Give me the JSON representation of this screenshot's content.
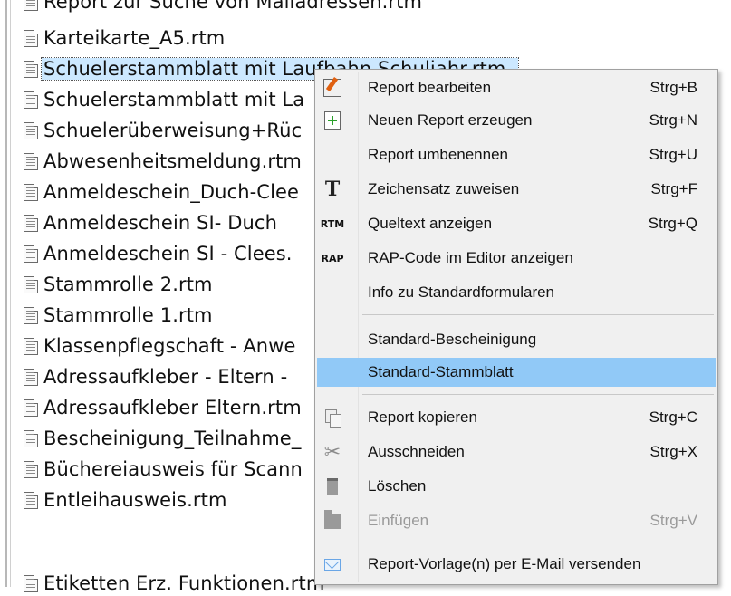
{
  "file_list": {
    "items": [
      {
        "name": "Report zur Suche von Mailadressen.rtm"
      },
      {
        "name": "Karteikarte_A5.rtm"
      },
      {
        "name": "Schuelerstammblatt mit Laufbahn Schuljahr.rtm",
        "selected": true
      },
      {
        "name": "Schuelerstammblatt mit La"
      },
      {
        "name": "Schuelerüberweisung+Rüc"
      },
      {
        "name": "Abwesenheitsmeldung.rtm"
      },
      {
        "name": "Anmeldeschein_Duch-Clee"
      },
      {
        "name": "Anmeldeschein SI-  Duch"
      },
      {
        "name": "Anmeldeschein SI - Clees."
      },
      {
        "name": "Stammrolle 2.rtm"
      },
      {
        "name": "Stammrolle 1.rtm"
      },
      {
        "name": "Klassenpflegschaft - Anwe"
      },
      {
        "name": "Adressaufkleber -  Eltern -"
      },
      {
        "name": "Adressaufkleber Eltern.rtm"
      },
      {
        "name": "Bescheinigung_Teilnahme_"
      },
      {
        "name": "Büchereiausweis für Scann"
      },
      {
        "name": "Entleihausweis.rtm"
      },
      {
        "name": "Etiketten Erz. Funktionen.rtm"
      }
    ]
  },
  "context_menu": {
    "items": [
      {
        "label": "Report bearbeiten",
        "shortcut": "Strg+B",
        "icon": "edit-report-icon"
      },
      {
        "label": "Neuen Report erzeugen",
        "shortcut": "Strg+N",
        "icon": "new-report-icon"
      },
      {
        "label": "Report umbenennen",
        "shortcut": "Strg+U",
        "icon": ""
      },
      {
        "label": "Zeichensatz zuweisen",
        "shortcut": "Strg+F",
        "icon": "font-icon"
      },
      {
        "label": "Queltext anzeigen",
        "shortcut": "Strg+Q",
        "icon": "rtm-icon"
      },
      {
        "label": "RAP-Code im Editor anzeigen",
        "shortcut": "",
        "icon": "rap-icon"
      },
      {
        "label": "Info zu Standardformularen",
        "shortcut": "",
        "icon": ""
      },
      {
        "label": "Standard-Bescheinigung",
        "shortcut": "",
        "icon": ""
      },
      {
        "label": "Standard-Stammblatt",
        "shortcut": "",
        "icon": "",
        "highlighted": true
      },
      {
        "label": "Report kopieren",
        "shortcut": "Strg+C",
        "icon": "copy-icon"
      },
      {
        "label": "Ausschneiden",
        "shortcut": "Strg+X",
        "icon": "scissors-icon"
      },
      {
        "label": "Löschen",
        "shortcut": "",
        "icon": "trash-icon"
      },
      {
        "label": "Einfügen",
        "shortcut": "Strg+V",
        "icon": "paste-icon",
        "disabled": true
      },
      {
        "label": "Report-Vorlage(n) per E-Mail versenden",
        "shortcut": "",
        "icon": "mail-icon"
      }
    ],
    "icon_glyphs": {
      "font": "T",
      "rtm": "RTM",
      "rap": "RAP",
      "scissors": "✂"
    }
  },
  "colors": {
    "selection_bg": "#cce8ff",
    "menu_highlight": "#91c9f7",
    "menu_bg": "#f0f0f0",
    "disabled_text": "#9a9a9a"
  }
}
